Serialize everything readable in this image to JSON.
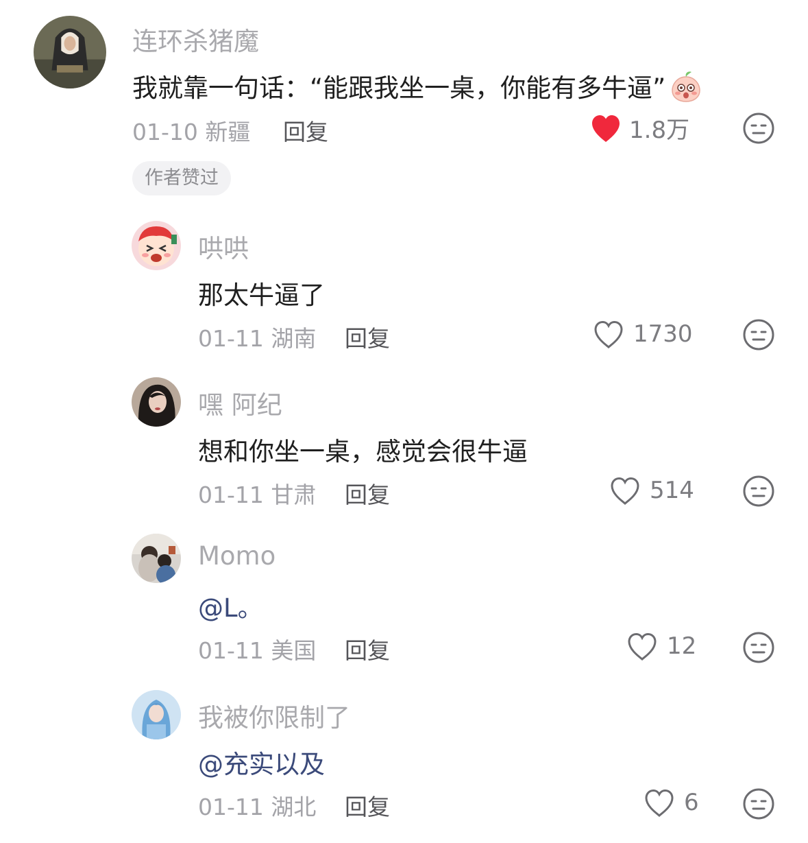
{
  "comments": [
    {
      "username": "连环杀猪魔",
      "text": "我就靠一句话：“能跟我坐一桌，你能有多牛逼”",
      "date": "01-10",
      "location": "新疆",
      "reply_label": "回复",
      "likes": "1.8万",
      "liked": true,
      "badge": "作者赞过"
    },
    {
      "username": "哄哄",
      "text": "那太牛逼了",
      "date": "01-11",
      "location": "湖南",
      "reply_label": "回复",
      "likes": "1730",
      "liked": false
    },
    {
      "username": "嘿 阿纪",
      "text": "想和你坐一桌，感觉会很牛逼",
      "date": "01-11",
      "location": "甘肃",
      "reply_label": "回复",
      "likes": "514",
      "liked": false
    },
    {
      "username": "Momo",
      "text": "@L。",
      "date": "01-11",
      "location": "美国",
      "reply_label": "回复",
      "likes": "12",
      "liked": false
    },
    {
      "username": "我被你限制了",
      "text": "@充实以及",
      "date": "01-11",
      "location": "湖北",
      "reply_label": "回复",
      "likes": "6",
      "liked": false
    }
  ],
  "icons": {
    "like_icon": "heart-icon",
    "dislike_icon": "meh-face-icon",
    "emoji": "peach-blush-emoji"
  },
  "colors": {
    "liked_heart": "#f0283c",
    "username": "#a9a9ad",
    "mention": "#3b4a7a"
  }
}
